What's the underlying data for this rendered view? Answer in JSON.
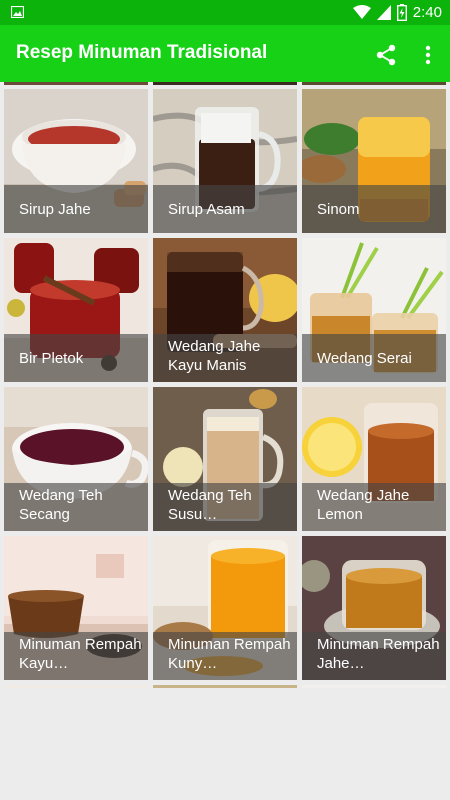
{
  "status_bar": {
    "time": "2:40",
    "icons": [
      "image-notification-icon",
      "wifi-icon",
      "cell-signal-icon",
      "battery-charging-icon"
    ]
  },
  "app_bar": {
    "title": "Resep Minuman Tradisional",
    "actions": [
      "share-icon",
      "more-vert-icon"
    ],
    "color": "#17d117",
    "status_color": "#0bb30b"
  },
  "recipes": [
    {
      "label": "Sirup Jahe"
    },
    {
      "label": "Sirup Asam"
    },
    {
      "label": "Sinom"
    },
    {
      "label": "Bir Pletok"
    },
    {
      "label": "Wedang Jahe Kayu Manis"
    },
    {
      "label": "Wedang Serai"
    },
    {
      "label": "Wedang Teh Secang"
    },
    {
      "label": "Wedang Teh Susu…"
    },
    {
      "label": "Wedang Jahe Lemon"
    },
    {
      "label": "Minuman Rempah Kayu…"
    },
    {
      "label": "Minuman Rempah Kuny…"
    },
    {
      "label": "Minuman Rempah Jahe…"
    }
  ]
}
